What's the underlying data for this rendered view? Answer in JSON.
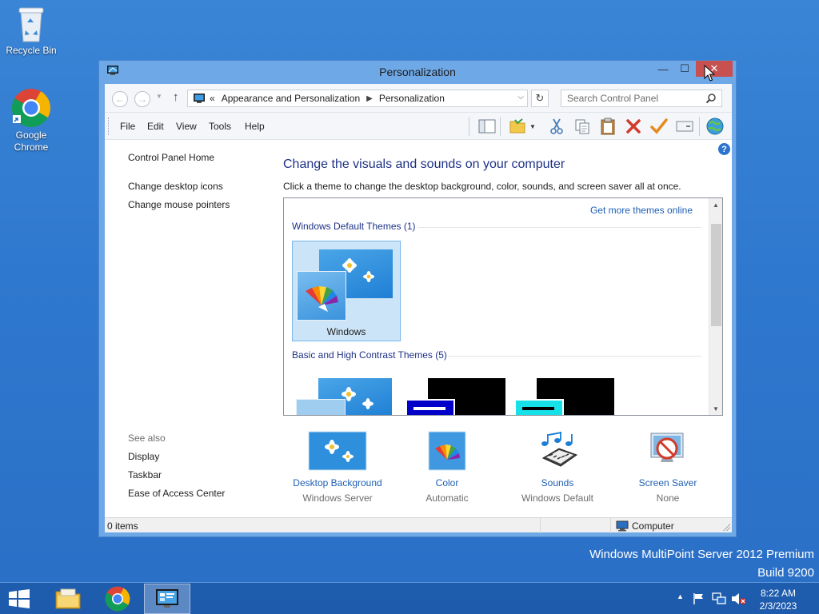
{
  "desktop": {
    "icons": [
      {
        "label": "Recycle Bin"
      },
      {
        "label": "Google\nChrome"
      }
    ],
    "watermark": {
      "line1": "Windows MultiPoint Server 2012 Premium",
      "line2": "Build 9200"
    }
  },
  "window": {
    "title": "Personalization",
    "controls": {
      "minimize": "—",
      "maximize": "☐",
      "close": "✕"
    }
  },
  "addressbar": {
    "overflow": "«",
    "breadcrumbs": [
      "Appearance and Personalization",
      "Personalization"
    ],
    "search_placeholder": "Search Control Panel"
  },
  "menu": {
    "items": [
      "File",
      "Edit",
      "View",
      "Tools",
      "Help"
    ]
  },
  "toolbar": {
    "icons": [
      "layout-icon",
      "folder-options-icon",
      "cut-icon",
      "copy-icon",
      "paste-icon",
      "delete-icon",
      "check-icon",
      "properties-icon",
      "globe-icon"
    ]
  },
  "sidebar": {
    "home": "Control Panel Home",
    "links": [
      "Change desktop icons",
      "Change mouse pointers"
    ],
    "see_also_heading": "See also",
    "see_also": [
      "Display",
      "Taskbar",
      "Ease of Access Center"
    ]
  },
  "main": {
    "title": "Change the visuals and sounds on your computer",
    "description": "Click a theme to change the desktop background, color, sounds, and screen saver all at once.",
    "get_more": "Get more themes online",
    "groups": [
      {
        "header": "Windows Default Themes (1)",
        "themes": [
          {
            "label": "Windows",
            "selected": true
          }
        ]
      },
      {
        "header": "Basic and High Contrast Themes (5)"
      }
    ]
  },
  "bottom": [
    {
      "label": "Desktop Background",
      "value": "Windows Server"
    },
    {
      "label": "Color",
      "value": "Automatic"
    },
    {
      "label": "Sounds",
      "value": "Windows Default"
    },
    {
      "label": "Screen Saver",
      "value": "None"
    }
  ],
  "status": {
    "items": "0 items",
    "location": "Computer"
  },
  "taskbar": {
    "apps": [
      "file-explorer-icon",
      "chrome-icon",
      "control-panel-icon"
    ],
    "time": "8:22 AM",
    "date": "2/3/2023"
  },
  "colors": {
    "link": "#1e5fb3",
    "heading": "#1e3287",
    "selection": "#cce4f7",
    "close": "#c75050"
  }
}
